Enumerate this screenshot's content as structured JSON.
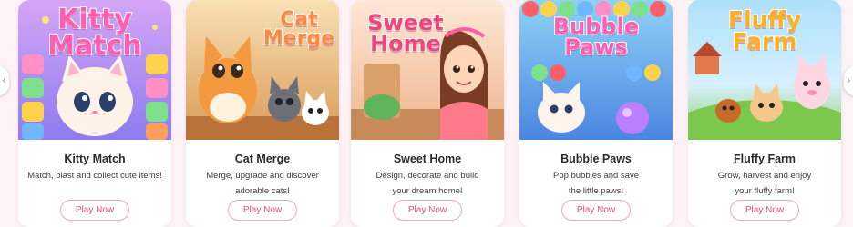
{
  "cards": [
    {
      "logo_lines": [
        "Kitty",
        "Match"
      ],
      "title": "Kitty Match",
      "desc_lines": [
        "Match, blast and collect cute items!"
      ],
      "button": "Play Now",
      "colors": {
        "bg_top": "#c99af2",
        "bg_bottom": "#8f7cf0",
        "logo": "#ff5fb3"
      }
    },
    {
      "logo_lines": [
        "Cat",
        "Merge"
      ],
      "title": "Cat Merge",
      "desc_lines": [
        "Merge, upgrade and discover",
        "adorable cats!"
      ],
      "button": "Play Now",
      "colors": {
        "bg_top": "#f7d9a8",
        "bg_bottom": "#e0a565",
        "logo": "#ff8a3d"
      }
    },
    {
      "logo_lines": [
        "Sweet",
        "Home"
      ],
      "title": "Sweet Home",
      "desc_lines": [
        "Design, decorate and build",
        "your dream home!"
      ],
      "button": "Play Now",
      "colors": {
        "bg_top": "#fbe2cf",
        "bg_bottom": "#f0b892",
        "logo": "#f0457d"
      }
    },
    {
      "logo_lines": [
        "Bubble",
        "Paws"
      ],
      "title": "Bubble Paws",
      "desc_lines": [
        "Pop bubbles and save",
        "the little paws!"
      ],
      "button": "Play Now",
      "colors": {
        "bg_top": "#7ec8f5",
        "bg_bottom": "#4f8fe6",
        "logo": "#ff5fb3"
      }
    },
    {
      "logo_lines": [
        "Fluffy",
        "Farm"
      ],
      "title": "Fluffy Farm",
      "desc_lines": [
        "Grow, harvest and enjoy",
        "your fluffy farm!"
      ],
      "button": "Play Now",
      "colors": {
        "bg_top": "#a8ddf7",
        "bg_bottom": "#8fd36a",
        "logo": "#ffb020"
      }
    }
  ],
  "nav": {
    "prev_icon": "chevron-left-icon",
    "next_icon": "chevron-right-icon"
  }
}
